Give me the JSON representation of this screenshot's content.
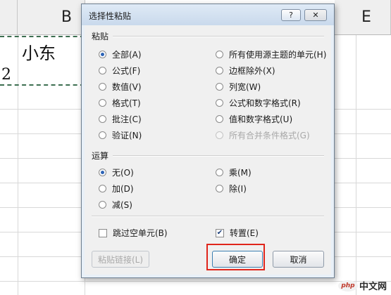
{
  "sheet": {
    "columns": [
      "B",
      "E"
    ],
    "cells": {
      "b1": "小东",
      "a2": "2"
    }
  },
  "dialog": {
    "title": "选择性粘贴",
    "help_icon": "question-mark-icon",
    "close_icon": "close-icon",
    "paste_section": "粘贴",
    "paste_left": [
      "全部(A)",
      "公式(F)",
      "数值(V)",
      "格式(T)",
      "批注(C)",
      "验证(N)"
    ],
    "paste_right": [
      "所有使用源主题的单元(H)",
      "边框除外(X)",
      "列宽(W)",
      "公式和数字格式(R)",
      "值和数字格式(U)",
      "所有合并条件格式(G)"
    ],
    "paste_selected": "全部(A)",
    "op_section": "运算",
    "op_left": [
      "无(O)",
      "加(D)",
      "减(S)"
    ],
    "op_right": [
      "乘(M)",
      "除(I)"
    ],
    "op_selected": "无(O)",
    "skip_blanks": "跳过空单元(B)",
    "skip_blanks_checked": false,
    "transpose": "转置(E)",
    "transpose_checked": true,
    "paste_link": "粘贴链接(L)",
    "ok": "确定",
    "cancel": "取消",
    "highlight_color": "#e0251b"
  },
  "watermark": {
    "logo": "php",
    "text": "中文网"
  }
}
